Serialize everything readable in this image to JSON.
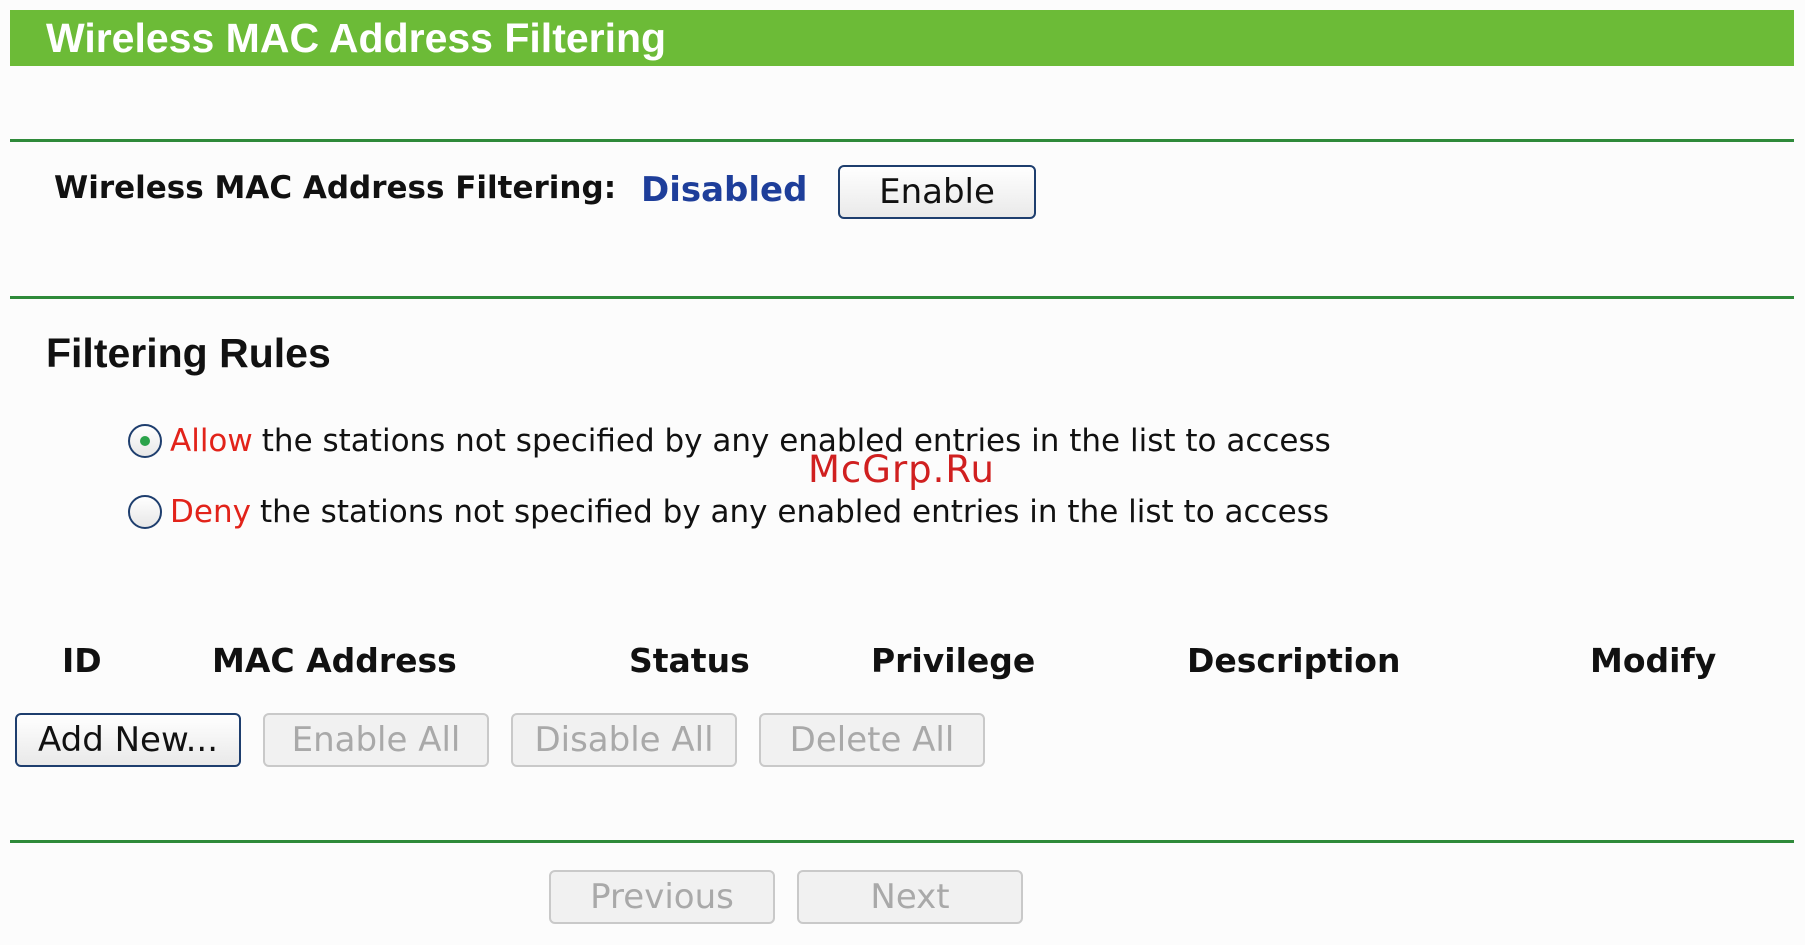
{
  "header": {
    "title": "Wireless MAC Address Filtering"
  },
  "filtering_status": {
    "label": "Wireless MAC Address Filtering:",
    "value": "Disabled",
    "enable_button": "Enable"
  },
  "filtering_rules": {
    "title": "Filtering Rules",
    "options": [
      {
        "keyword": "Allow",
        "text": "the stations not specified by any enabled entries in the list to access",
        "selected": true
      },
      {
        "keyword": "Deny",
        "text": "the stations not specified by any enabled entries in the list to access",
        "selected": false
      }
    ]
  },
  "watermark": "McGrp.Ru",
  "table": {
    "columns": [
      "ID",
      "MAC Address",
      "Status",
      "Privilege",
      "Description",
      "Modify"
    ]
  },
  "actions": {
    "add_new": "Add New...",
    "enable_all": "Enable All",
    "disable_all": "Disable All",
    "delete_all": "Delete All"
  },
  "pagination": {
    "previous": "Previous",
    "next": "Next"
  },
  "colors": {
    "header_bg": "#6cbb37",
    "divider": "#2f8a3a",
    "status_value": "#1e3e9a",
    "keyword": "#e2231a"
  }
}
